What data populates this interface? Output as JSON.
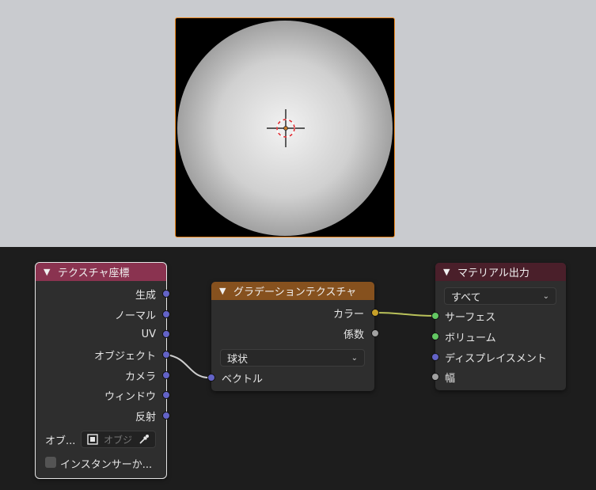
{
  "texcoord": {
    "title": "テクスチャ座標",
    "outputs": [
      "生成",
      "ノーマル",
      "UV",
      "オブジェクト",
      "カメラ",
      "ウィンドウ",
      "反射"
    ],
    "object_label": "オブ...",
    "object_placeholder": "オブジ",
    "instancer_label": "インスタンサーか..."
  },
  "gradient": {
    "title": "グラデーションテクスチャ",
    "outputs": [
      "カラー",
      "係数"
    ],
    "type_value": "球状",
    "inputs": [
      "ベクトル"
    ]
  },
  "output": {
    "title": "マテリアル出力",
    "target_value": "すべて",
    "inputs": [
      "サーフェス",
      "ボリューム",
      "ディスプレイスメント",
      "幅"
    ]
  },
  "colors": {
    "texcoord_header": "#8a3350",
    "gradient_header": "#86511e",
    "output_header": "#4a1f2a",
    "render_border": "#f08a1c"
  }
}
